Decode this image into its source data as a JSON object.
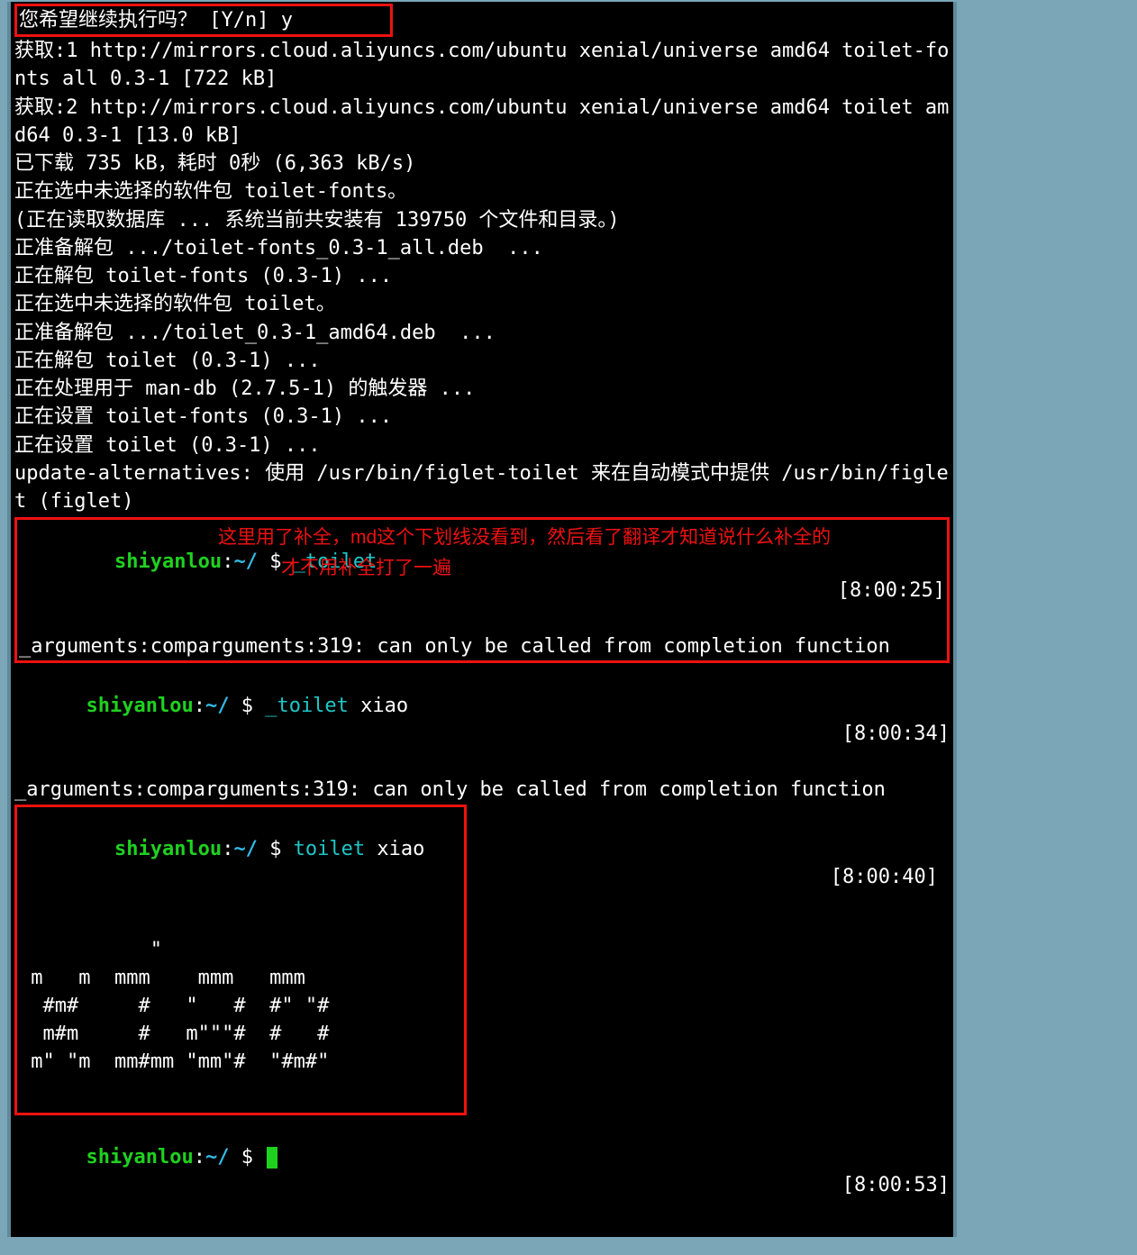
{
  "question_line": "您希望继续执行吗？ [Y/n] y",
  "apt_output": [
    "获取:1 http://mirrors.cloud.aliyuncs.com/ubuntu xenial/universe amd64 toilet-fonts all 0.3-1 [722 kB]",
    "获取:2 http://mirrors.cloud.aliyuncs.com/ubuntu xenial/universe amd64 toilet amd64 0.3-1 [13.0 kB]",
    "已下载 735 kB，耗时 0秒 (6,363 kB/s)",
    "正在选中未选择的软件包 toilet-fonts。",
    "(正在读取数据库 ... 系统当前共安装有 139750 个文件和目录。)",
    "正准备解包 .../toilet-fonts_0.3-1_all.deb  ...",
    "正在解包 toilet-fonts (0.3-1) ...",
    "正在选中未选择的软件包 toilet。",
    "正准备解包 .../toilet_0.3-1_amd64.deb  ...",
    "正在解包 toilet (0.3-1) ...",
    "正在处理用于 man-db (2.7.5-1) 的触发器 ...",
    "正在设置 toilet-fonts (0.3-1) ...",
    "正在设置 toilet (0.3-1) ...",
    "update-alternatives: 使用 /usr/bin/figlet-toilet 来在自动模式中提供 /usr/bin/figlet (figlet)"
  ],
  "annotation1": "这里用了补全，md这个下划线没看到，然后看了翻译才知道说什么补全的",
  "annotation2": "才不用补全打了一遍",
  "prompts": [
    {
      "user": "shiyanlou",
      "path": "~/",
      "sym": "$",
      "cmd": "_toilet",
      "arg": "",
      "time": "[8:00:25]"
    },
    {
      "user": "shiyanlou",
      "path": "~/",
      "sym": "$",
      "cmd": "_toilet",
      "arg": " xiao",
      "time": "[8:00:34]"
    },
    {
      "user": "shiyanlou",
      "path": "~/",
      "sym": "$",
      "cmd": "toilet",
      "arg": " xiao",
      "time": "[8:00:40]"
    },
    {
      "user": "shiyanlou",
      "path": "~/",
      "sym": "$",
      "cmd": "",
      "arg": "",
      "time": "[8:00:53]"
    }
  ],
  "error_line": "_arguments:comparguments:319: can only be called from completion function",
  "ascii_art": "           \"\n m   m  mmm    mmm   mmm\n  #m#     #   \"   #  #\" \"#\n  m#m     #   m\"\"\"#  #   #\n m\" \"m  mm#mm \"mm\"#  \"#m#\"\n"
}
